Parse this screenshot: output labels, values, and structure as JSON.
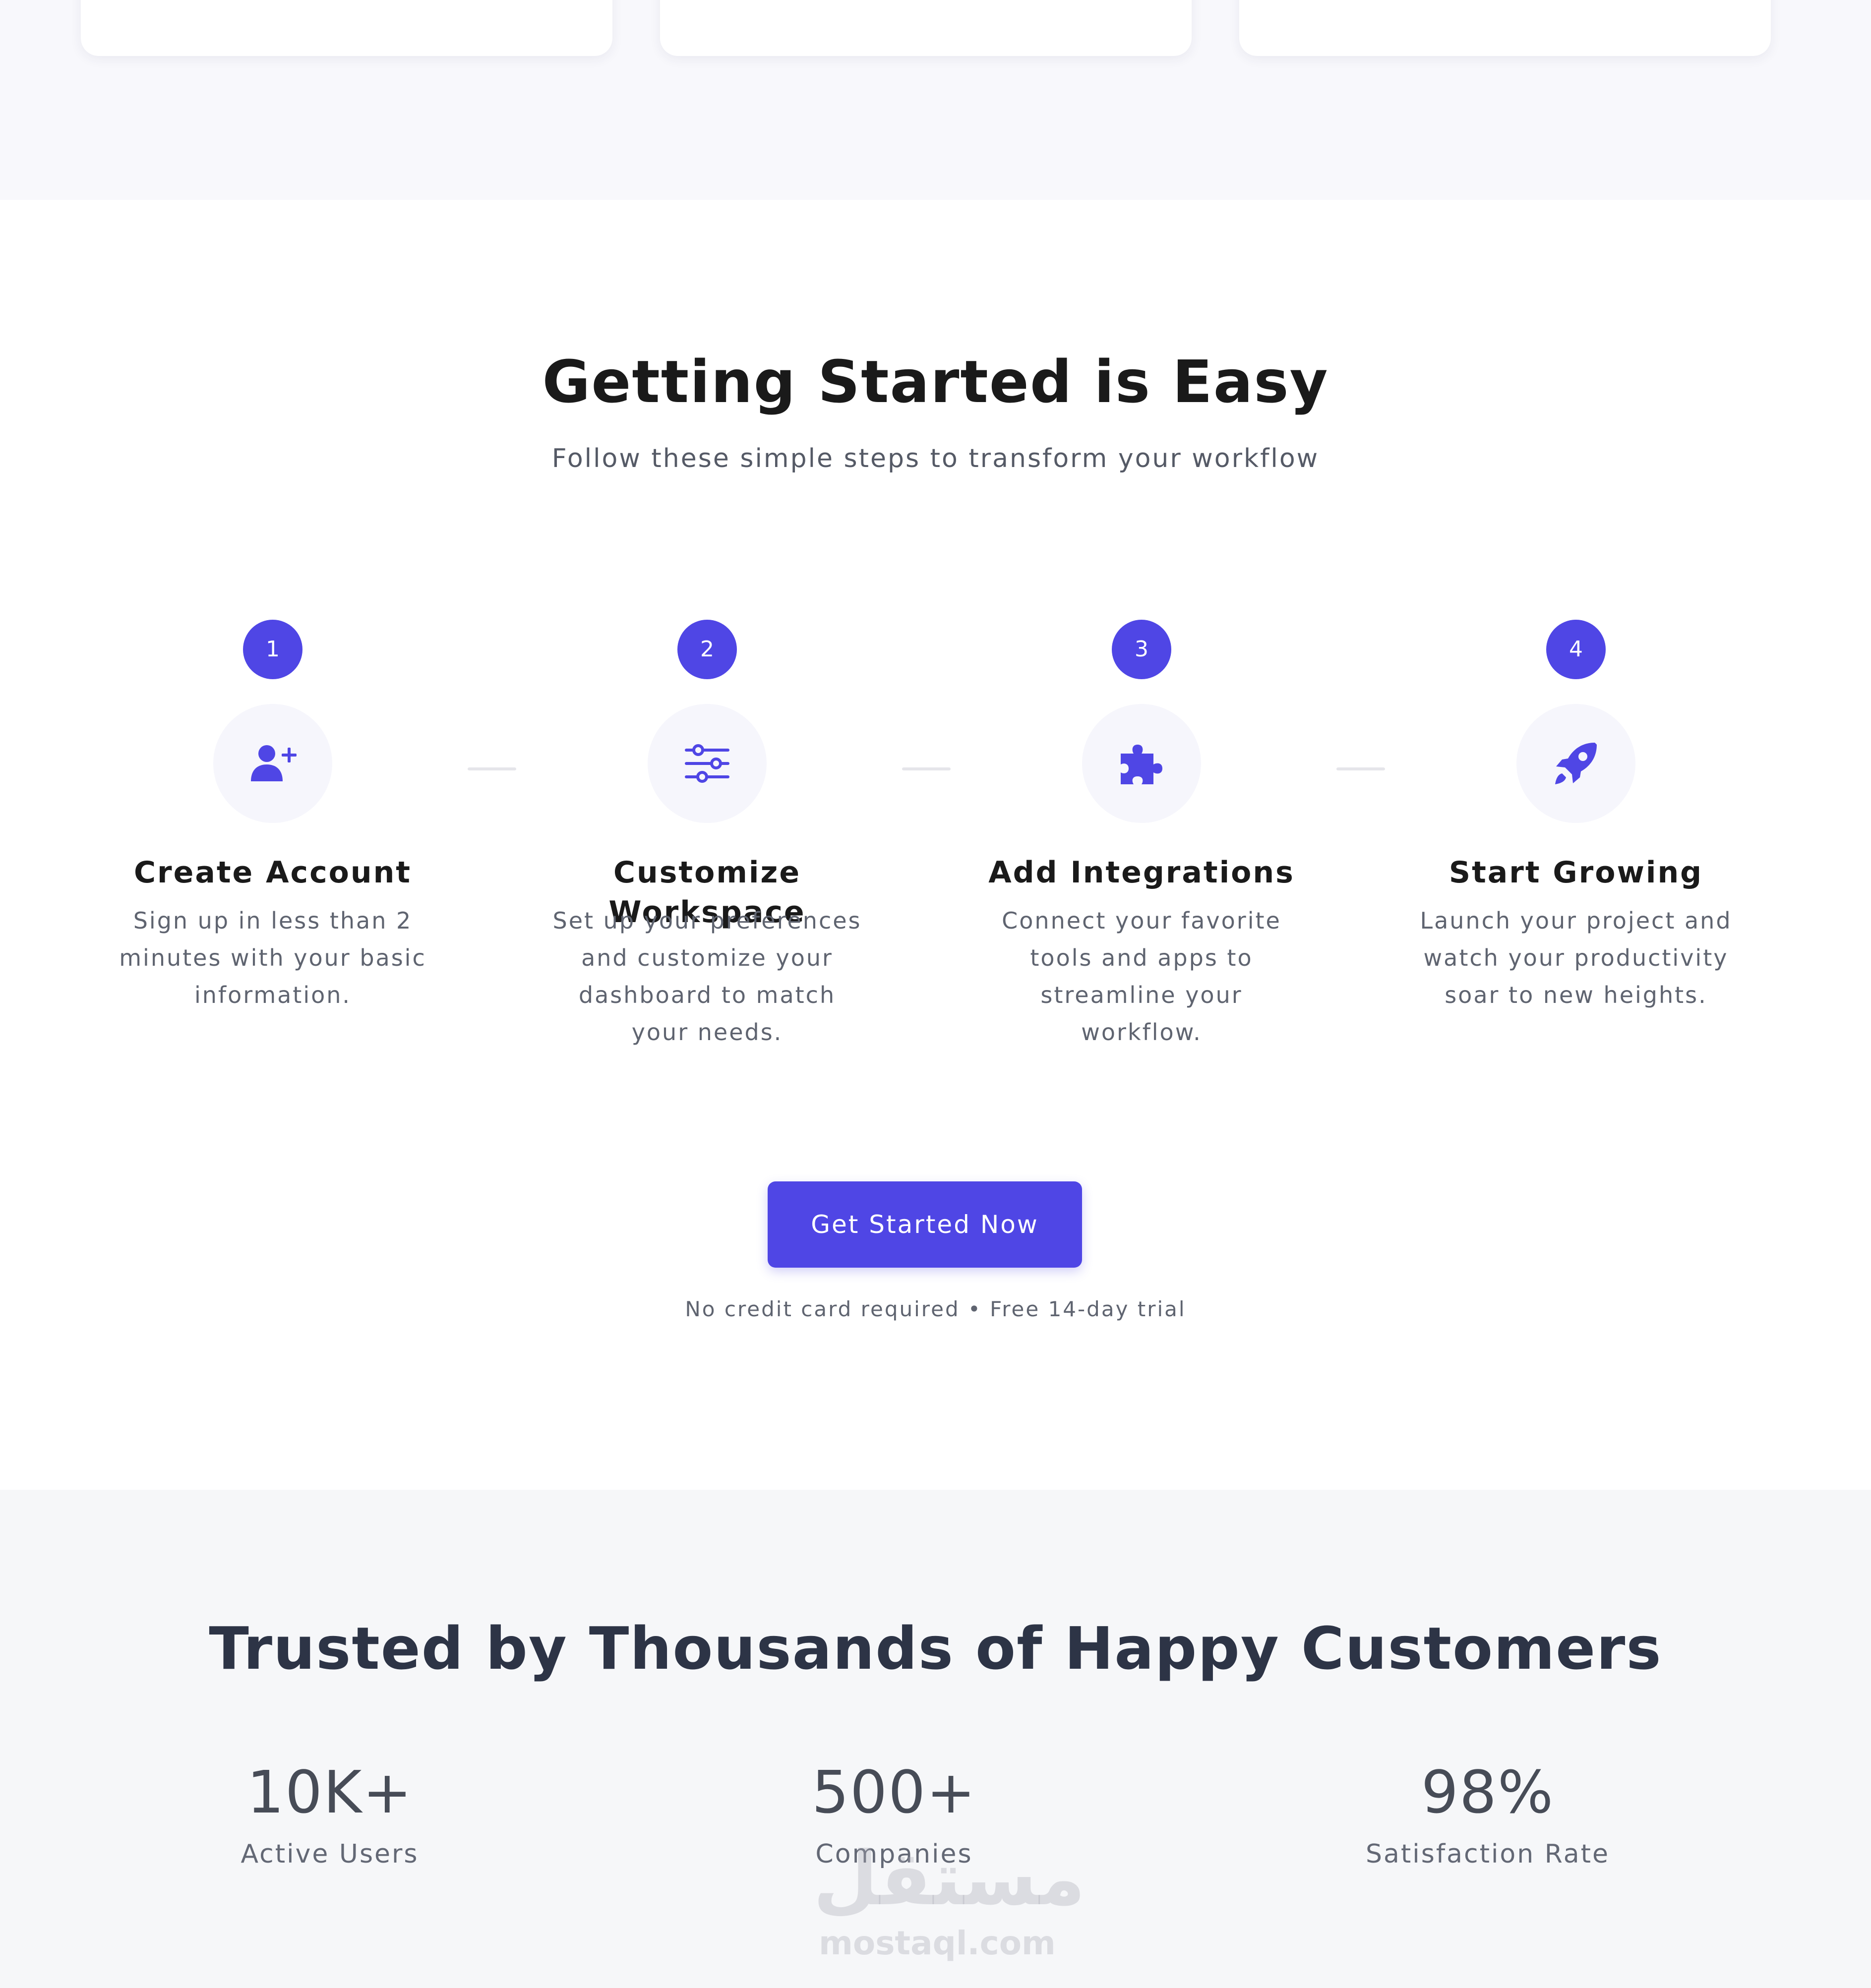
{
  "getting_started": {
    "title": "Getting Started is Easy",
    "subtitle": "Follow these simple steps to transform your workflow",
    "steps": [
      {
        "number": "1",
        "icon": "user-plus-icon",
        "title": "Create Account",
        "description": "Sign up in less than 2 minutes with your basic information."
      },
      {
        "number": "2",
        "icon": "sliders-icon",
        "title": "Customize Workspace",
        "description": "Set up your preferences and customize your dashboard to match your needs."
      },
      {
        "number": "3",
        "icon": "puzzle-icon",
        "title": "Add Integrations",
        "description": "Connect your favorite tools and apps to streamline your workflow."
      },
      {
        "number": "4",
        "icon": "rocket-icon",
        "title": "Start Growing",
        "description": "Launch your project and watch your productivity soar to new heights."
      }
    ],
    "cta_label": "Get Started Now",
    "cta_note": "No credit card required • Free 14-day trial"
  },
  "trusted": {
    "title": "Trusted by Thousands of Happy Customers",
    "stats": [
      {
        "value": "10K+",
        "label": "Active Users"
      },
      {
        "value": "500+",
        "label": "Companies"
      },
      {
        "value": "98%",
        "label": "Satisfaction Rate"
      }
    ]
  },
  "watermark": {
    "arabic": "مستقل",
    "latin": "mostaql.com"
  },
  "colors": {
    "accent": "#4f46e5",
    "top_band": "#f8f8fc",
    "trusted_band": "#f6f7f9",
    "icon_circle": "#f6f6fc"
  }
}
